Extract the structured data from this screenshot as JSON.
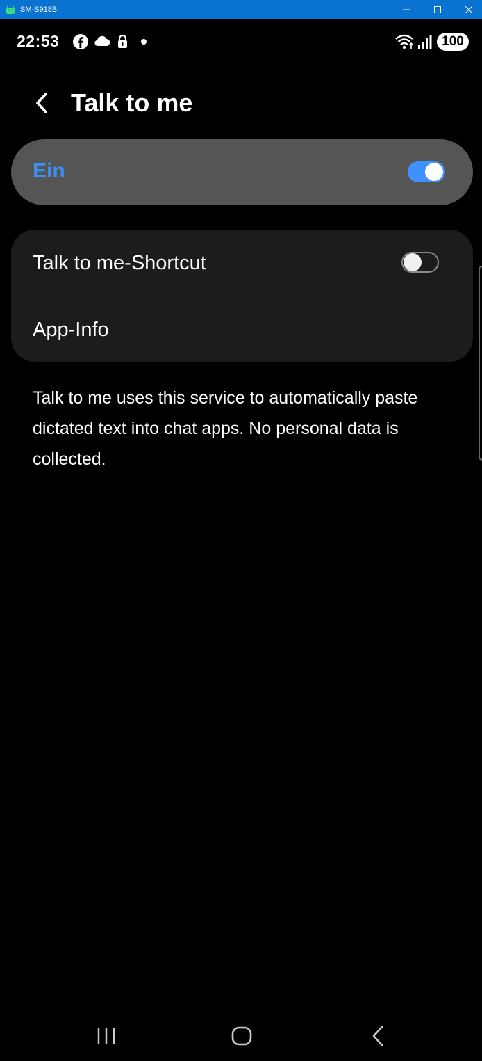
{
  "window": {
    "title": "SM-S918B"
  },
  "status_bar": {
    "time": "22:53",
    "battery": "100",
    "icons": [
      "facebook-icon",
      "cloud-icon",
      "lock-icon",
      "dot-icon",
      "wifi-icon",
      "signal-icon"
    ]
  },
  "header": {
    "title": "Talk to me"
  },
  "master_switch": {
    "label": "Ein",
    "enabled": true,
    "accent": "#3d8ff5"
  },
  "settings": {
    "shortcut_label": "Talk to me-Shortcut",
    "shortcut_enabled": false,
    "app_info_label": "App-Info"
  },
  "description": "Talk to me uses this service to automatically paste dictated text into chat apps. No personal data is collected.",
  "nav_bar": {
    "buttons": [
      "recent-apps",
      "home",
      "back"
    ]
  }
}
